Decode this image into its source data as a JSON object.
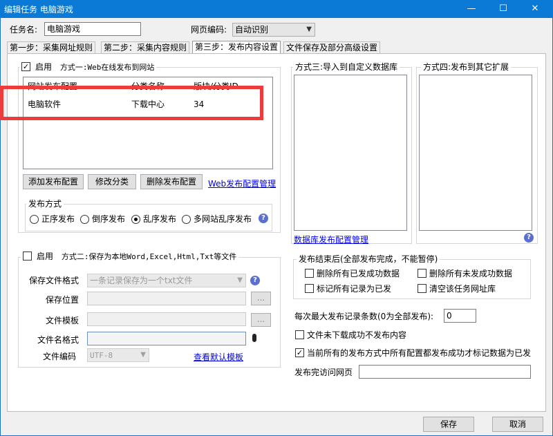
{
  "window": {
    "title": "编辑任务 电脑游戏",
    "minimize": "—",
    "maximize": "☐",
    "close": "✕"
  },
  "task": {
    "name_label": "任务名:",
    "name_value": "电脑游戏",
    "encoding_label": "网页编码:",
    "encoding_value": "自动识别"
  },
  "tabs": [
    {
      "label": "第一步：采集网址规则"
    },
    {
      "label": "第二步：采集内容规则"
    },
    {
      "label": "第三步：发布内容设置"
    },
    {
      "label": "文件保存及部分高级设置"
    }
  ],
  "method1": {
    "enable_label": "启用",
    "title": "方式一:Web在线发布到网站",
    "enabled": true,
    "columns": [
      "网站发布配置",
      "分类名称",
      "版块/分类ID"
    ],
    "rows": [
      {
        "config": "电脑软件",
        "category": "下载中心",
        "id": "34"
      }
    ],
    "btn_add": "添加发布配置",
    "btn_edit": "修改分类",
    "btn_delete": "删除发布配置",
    "link_manage": "Web发布配置管理",
    "publish_mode_title": "发布方式",
    "modes": [
      "正序发布",
      "倒序发布",
      "乱序发布",
      "多网站乱序发布"
    ],
    "selected_mode": "乱序发布"
  },
  "method3": {
    "title": "方式三:导入到自定义数据库",
    "link_manage": "数据库发布配置管理"
  },
  "method4": {
    "title": "方式四:发布到其它扩展"
  },
  "method2": {
    "enable_label": "启用",
    "title": "方式二:保存为本地Word,Excel,Html,Txt等文件",
    "enabled": false,
    "format_label": "保存文件格式",
    "format_value": "一条记录保存为一个txt文件",
    "location_label": "保存位置",
    "location_value": "",
    "template_label": "文件模板",
    "template_value": "",
    "filename_label": "文件名格式",
    "filename_value": "",
    "encoding_label": "文件编码",
    "encoding_value": "UTF-8",
    "browse": "...",
    "link_default_template": "查看默认模板"
  },
  "after_publish": {
    "title": "发布结束后(全部发布完成，不能暂停)",
    "options": [
      {
        "label": "删除所有已发成功数据",
        "checked": false
      },
      {
        "label": "删除所有未发成功数据",
        "checked": false
      },
      {
        "label": "标记所有记录为已发",
        "checked": false
      },
      {
        "label": "清空该任务网址库",
        "checked": false
      }
    ]
  },
  "settings": {
    "max_records_label": "每次最大发布记录条数(0为全部发布):",
    "max_records_value": "0",
    "skip_if_file_fail_label": "文件未下载成功不发布内容",
    "skip_if_file_fail": false,
    "mark_only_all_success_label": "当前所有的发布方式中所有配置都发布成功才标记数据为已发",
    "mark_only_all_success": true,
    "visit_after_label": "发布完访问网页",
    "visit_after_value": ""
  },
  "footer": {
    "save": "保存",
    "cancel": "取消"
  },
  "colors": {
    "titlebar": "#0a7ad6",
    "highlight_box": "#ee3b3b",
    "link": "#0000ee"
  }
}
